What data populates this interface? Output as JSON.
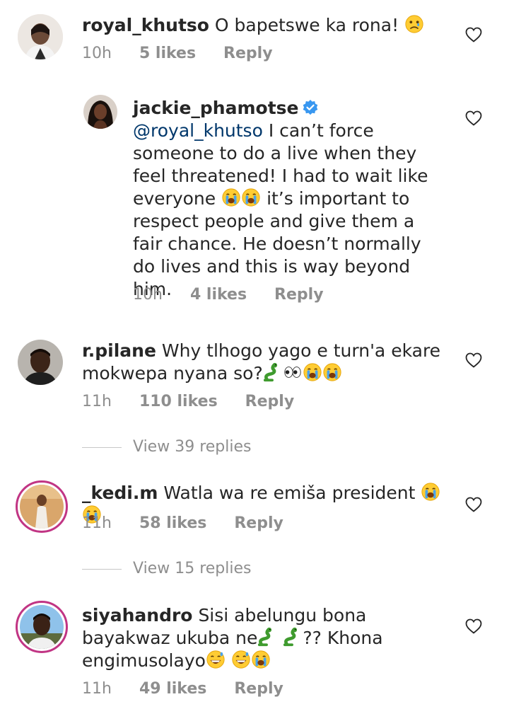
{
  "comments": [
    {
      "username": "royal_khutso",
      "text": "O bapetswe ka rona!",
      "time": "10h",
      "likes": "5 likes",
      "reply": "Reply",
      "avatar_icon": "avatar-royal-khutso",
      "emoji": [
        "sad-face-emoji"
      ]
    },
    {
      "username": "jackie_phamotse",
      "verified": true,
      "mention": "@royal_khutso",
      "text_part1": "I can’t force someone to do a live when they feel threatened! I had to wait like everyone",
      "text_part2": "it’s important to respect people and give them a fair chance. He doesn’t normally do lives and this is way beyond him.",
      "time": "10h",
      "likes": "4 likes",
      "reply": "Reply",
      "emoji": [
        "crying-face-emoji",
        "crying-face-emoji"
      ]
    },
    {
      "username": "r.pilane",
      "text_part1": "Why tlhogo yago e turn'a ekare mokwepa  nyana so?",
      "time": "11h",
      "likes": "110 likes",
      "reply": "Reply",
      "view_replies": "View 39 replies",
      "emoji": [
        "snake-emoji",
        "eyes-emoji",
        "crying-face-emoji",
        "crying-face-emoji"
      ]
    },
    {
      "username": "_kedi.m",
      "text": "Watla wa re emiša president",
      "time": "11h",
      "likes": "58 likes",
      "reply": "Reply",
      "view_replies": "View 15 replies",
      "emoji": [
        "crying-face-emoji",
        "crying-face-emoji"
      ]
    },
    {
      "username": "siyahandro",
      "text_part1": "Sisi abelungu bona bayakwaz ukuba ne",
      "text_part2": "?? Khona engimusolayo",
      "time": "11h",
      "likes": "49 likes",
      "reply": "Reply",
      "emoji": [
        "snake-emoji",
        "snake-emoji",
        "grinning-sweat-emoji",
        "grinning-sweat-emoji",
        "crying-face-emoji"
      ]
    }
  ],
  "colors": {
    "text": "#262626",
    "muted": "#8e8e8e",
    "mention": "#00376b",
    "verified": "#3897f0",
    "story_ring": "#c13584"
  }
}
